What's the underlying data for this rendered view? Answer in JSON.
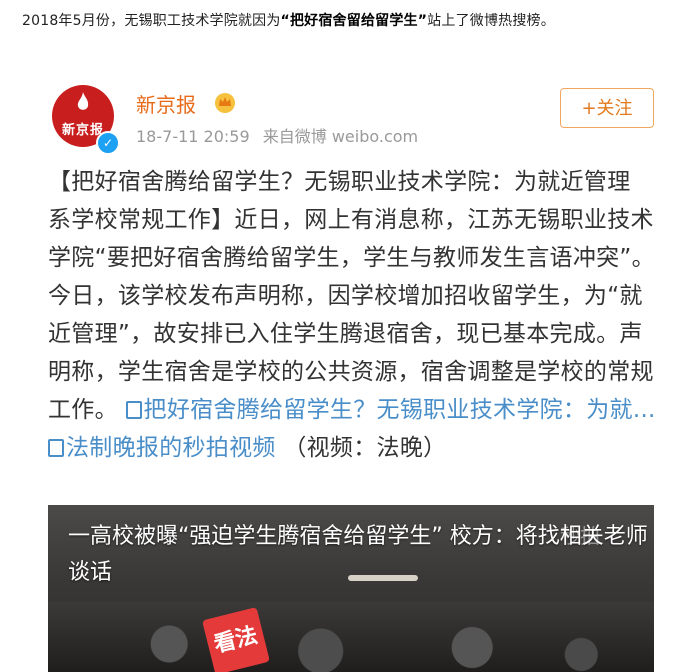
{
  "intro": {
    "before": "2018年5月份，无锡职工技术学院就因为",
    "highlight": "“把好宿舍留给留学生”",
    "after": "站上了微博热搜榜。"
  },
  "post": {
    "avatar_text": "新京报",
    "author": "新京报",
    "date": "18-7-11 20:59",
    "source": "来自微博 weibo.com",
    "follow_label": "+关注",
    "body": "【把好宿舍腾给留学生？无锡职业技术学院：为就近管理 系学校常规工作】近日，网上有消息称，江苏无锡职业技术学院“要把好宿舍腾给留学生，学生与教师发生言语冲突”。今日，该学校发布声明称，因学校增加招收留学生，为“就近管理”，故安排已入住学生腾退宿舍，现已基本完成。声明称，学生宿舍是学校的公共资源，宿舍调整是学校的常规工作。",
    "link1": "把好宿舍腾给留学生？无锡职业技术学院：为就...",
    "link2": "法制晚报的秒拍视频",
    "tail": "（视频：法晚）"
  },
  "video": {
    "caption": "一高校被曝“强迫学生腾宿舍给留学生” 校方：将找相关老师谈话",
    "watermark": "秒拍",
    "badge": "看法"
  },
  "colors": {
    "author": "#e86b1a",
    "link": "#4a8ec9",
    "follow_border": "#f0a860",
    "avatar_bg": "#c81e1e"
  },
  "icons": [
    "flame-logo-icon",
    "verified-icon",
    "crown-vip-icon",
    "link-icon",
    "video-link-icon"
  ]
}
